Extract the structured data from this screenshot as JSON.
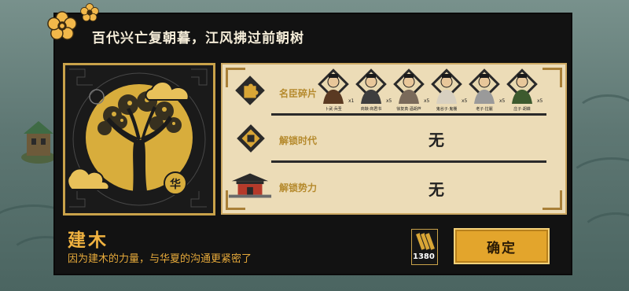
{
  "dialog": {
    "title": "百代兴亡复朝暮，江风拂过前朝树",
    "building_name": "建木",
    "description": "因为建木的力量，与华夏的沟通更紧密了",
    "seal_char": "华",
    "confirm_label": "确定",
    "resource_count": "1380"
  },
  "rows": {
    "fragments_label": "名臣碎片",
    "era_label": "解锁时代",
    "era_value": "无",
    "faction_label": "解锁势力",
    "faction_value": "无"
  },
  "heroes": [
    {
      "name": "卜武·兵圣",
      "count": "x1",
      "robe": "#5a3a22"
    },
    {
      "name": "商鞅·商君书",
      "count": "x5",
      "robe": "#3e3e3e"
    },
    {
      "name": "徐复真·酒胡芦",
      "count": "x5",
      "robe": "#7a6a5a"
    },
    {
      "name": "鬼谷子·鬼棚",
      "count": "x5",
      "robe": "#d8d0c0"
    },
    {
      "name": "老子·拉麗",
      "count": "x5",
      "robe": "#9a9a9a"
    },
    {
      "name": "庄子·胡蝶",
      "count": "x5",
      "robe": "#3d5a2e"
    }
  ],
  "colors": {
    "gold": "#c9a24a",
    "parchment": "#ecdcb7",
    "button": "#e3a52c",
    "panel": "#121212"
  },
  "icons": {
    "fragments": "puzzle-icon",
    "era": "diamond-emblem-icon",
    "faction": "palace-icon",
    "resource": "wood-bundle-icon",
    "flower": "plum-blossom-icon"
  }
}
